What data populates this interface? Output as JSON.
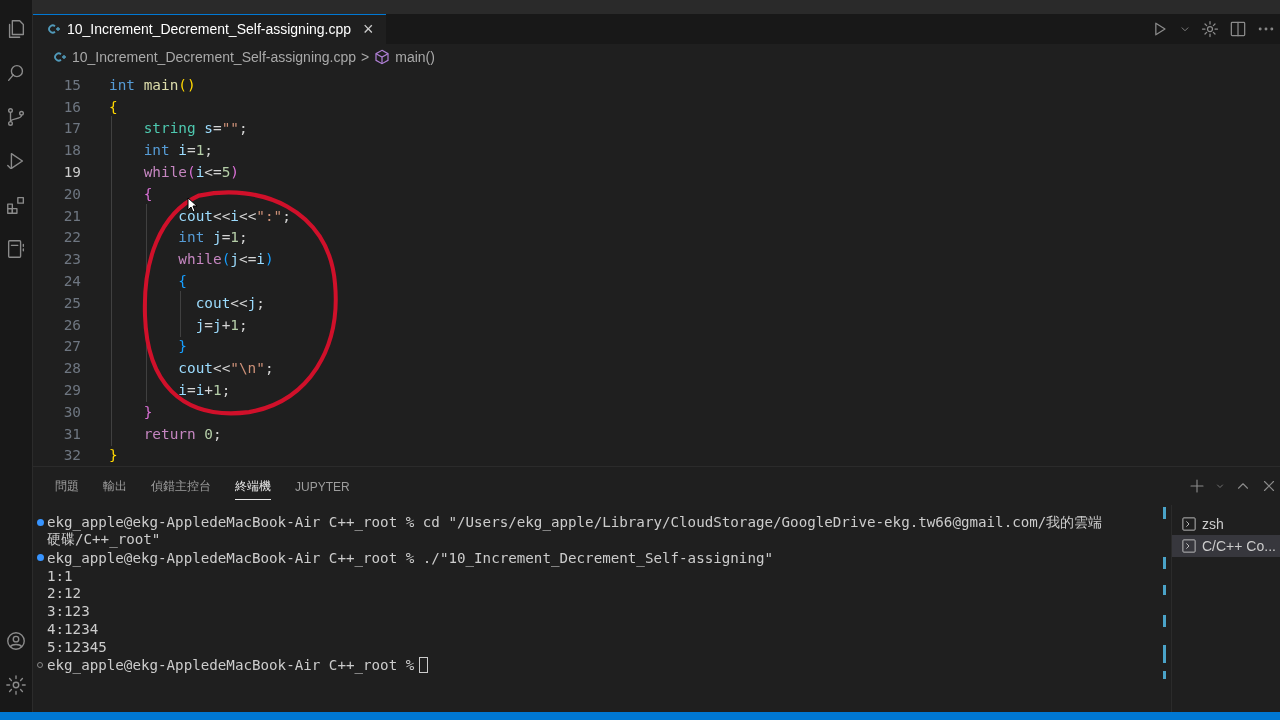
{
  "editor_tab": {
    "label": "10_Increment_Decrement_Self-assigning.cpp",
    "close": "×",
    "selected": true
  },
  "breadcrumb": {
    "file": "10_Increment_Decrement_Self-assigning.cpp",
    "separator": ">",
    "symbol": "main()"
  },
  "code_lines": [
    {
      "number": "15",
      "current": false,
      "tokens": [
        {
          "kind": "type",
          "text": "int"
        },
        {
          "kind": "function",
          "text": " main"
        },
        {
          "kind": "bracket1",
          "text": "()"
        }
      ]
    },
    {
      "number": "16",
      "current": false,
      "tokens": [
        {
          "kind": "bracket1",
          "text": "{"
        }
      ]
    },
    {
      "number": "17",
      "current": false,
      "tokens": [
        {
          "kind": "class",
          "text": "    string"
        },
        {
          "kind": "variable",
          "text": " s"
        },
        {
          "kind": "plain",
          "text": "="
        },
        {
          "kind": "string",
          "text": "\"\""
        },
        {
          "kind": "plain",
          "text": ";"
        }
      ]
    },
    {
      "number": "18",
      "current": false,
      "tokens": [
        {
          "kind": "type",
          "text": "    int"
        },
        {
          "kind": "variable",
          "text": " i"
        },
        {
          "kind": "plain",
          "text": "="
        },
        {
          "kind": "number",
          "text": "1"
        },
        {
          "kind": "plain",
          "text": ";"
        }
      ]
    },
    {
      "number": "19",
      "current": true,
      "tokens": [
        {
          "kind": "control",
          "text": "    while"
        },
        {
          "kind": "bracket2",
          "text": "("
        },
        {
          "kind": "variable",
          "text": "i"
        },
        {
          "kind": "plain",
          "text": "<="
        },
        {
          "kind": "number",
          "text": "5"
        },
        {
          "kind": "bracket2",
          "text": ")"
        }
      ]
    },
    {
      "number": "20",
      "current": false,
      "tokens": [
        {
          "kind": "bracket2",
          "text": "    {"
        }
      ]
    },
    {
      "number": "21",
      "current": false,
      "tokens": [
        {
          "kind": "variable",
          "text": "        cout"
        },
        {
          "kind": "plain",
          "text": "<<"
        },
        {
          "kind": "variable",
          "text": "i"
        },
        {
          "kind": "plain",
          "text": "<<"
        },
        {
          "kind": "string",
          "text": "\":\""
        },
        {
          "kind": "plain",
          "text": ";"
        }
      ]
    },
    {
      "number": "22",
      "current": false,
      "tokens": [
        {
          "kind": "type",
          "text": "        int"
        },
        {
          "kind": "variable",
          "text": " j"
        },
        {
          "kind": "plain",
          "text": "="
        },
        {
          "kind": "number",
          "text": "1"
        },
        {
          "kind": "plain",
          "text": ";"
        }
      ]
    },
    {
      "number": "23",
      "current": false,
      "tokens": [
        {
          "kind": "control",
          "text": "        while"
        },
        {
          "kind": "bracket3",
          "text": "("
        },
        {
          "kind": "variable",
          "text": "j"
        },
        {
          "kind": "plain",
          "text": "<="
        },
        {
          "kind": "variable",
          "text": "i"
        },
        {
          "kind": "bracket3",
          "text": ")"
        }
      ]
    },
    {
      "number": "24",
      "current": false,
      "tokens": [
        {
          "kind": "bracket3",
          "text": "        {"
        }
      ]
    },
    {
      "number": "25",
      "current": false,
      "tokens": [
        {
          "kind": "variable",
          "text": "          cout"
        },
        {
          "kind": "plain",
          "text": "<<"
        },
        {
          "kind": "variable",
          "text": "j"
        },
        {
          "kind": "plain",
          "text": ";"
        }
      ]
    },
    {
      "number": "26",
      "current": false,
      "tokens": [
        {
          "kind": "variable",
          "text": "          j"
        },
        {
          "kind": "plain",
          "text": "="
        },
        {
          "kind": "variable",
          "text": "j"
        },
        {
          "kind": "plain",
          "text": "+"
        },
        {
          "kind": "number",
          "text": "1"
        },
        {
          "kind": "plain",
          "text": ";"
        }
      ]
    },
    {
      "number": "27",
      "current": false,
      "tokens": [
        {
          "kind": "bracket3",
          "text": "        }"
        }
      ]
    },
    {
      "number": "28",
      "current": false,
      "tokens": [
        {
          "kind": "variable",
          "text": "        cout"
        },
        {
          "kind": "plain",
          "text": "<<"
        },
        {
          "kind": "string",
          "text": "\"\\n\""
        },
        {
          "kind": "plain",
          "text": ";"
        }
      ]
    },
    {
      "number": "29",
      "current": false,
      "tokens": [
        {
          "kind": "variable",
          "text": "        i"
        },
        {
          "kind": "plain",
          "text": "="
        },
        {
          "kind": "variable",
          "text": "i"
        },
        {
          "kind": "plain",
          "text": "+"
        },
        {
          "kind": "number",
          "text": "1"
        },
        {
          "kind": "plain",
          "text": ";"
        }
      ]
    },
    {
      "number": "30",
      "current": false,
      "tokens": [
        {
          "kind": "bracket2",
          "text": "    }"
        }
      ]
    },
    {
      "number": "31",
      "current": false,
      "tokens": [
        {
          "kind": "control",
          "text": "    return"
        },
        {
          "kind": "number",
          "text": " 0"
        },
        {
          "kind": "plain",
          "text": ";"
        }
      ]
    },
    {
      "number": "32",
      "current": false,
      "tokens": [
        {
          "kind": "bracket1",
          "text": "}"
        }
      ]
    }
  ],
  "panel_tabs": [
    {
      "label": "問題",
      "selected": false
    },
    {
      "label": "輸出",
      "selected": false
    },
    {
      "label": "偵錯主控台",
      "selected": false
    },
    {
      "label": "終端機",
      "selected": true
    },
    {
      "label": "JUPYTER",
      "selected": false
    }
  ],
  "terminal_lines": [
    {
      "kind": "done",
      "text": "ekg_apple@ekg-AppledeMacBook-Air C++_root % cd \"/Users/ekg_apple/Library/CloudStorage/GoogleDrive-ekg.tw66@gmail.com/我的雲端"
    },
    {
      "kind": "output",
      "text": "硬碟/C++_root\""
    },
    {
      "kind": "done",
      "text": "ekg_apple@ekg-AppledeMacBook-Air C++_root % ./\"10_Increment_Decrement_Self-assigning\""
    },
    {
      "kind": "output",
      "text": "1:1"
    },
    {
      "kind": "output",
      "text": "2:12"
    },
    {
      "kind": "output",
      "text": "3:123"
    },
    {
      "kind": "output",
      "text": "4:1234"
    },
    {
      "kind": "output",
      "text": "5:12345"
    },
    {
      "kind": "prompt",
      "text": "ekg_apple@ekg-AppledeMacBook-Air C++_root %"
    }
  ],
  "terminal_list": [
    {
      "label": "zsh",
      "selected": false
    },
    {
      "label": "C/C++ Co...",
      "selected": true
    }
  ]
}
